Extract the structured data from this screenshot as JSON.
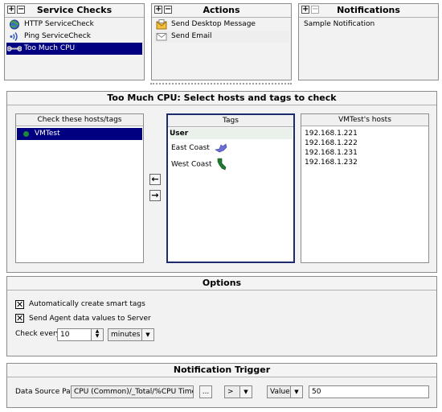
{
  "service_checks": {
    "title": "Service Checks",
    "items": [
      {
        "label": "HTTP ServiceCheck",
        "icon": "globe-icon"
      },
      {
        "label": "Ping ServiceCheck",
        "icon": "ping-waves-icon"
      },
      {
        "label": "Too Much CPU",
        "icon": "wrench-icon",
        "selected": true
      }
    ]
  },
  "actions": {
    "title": "Actions",
    "items": [
      {
        "label": "Send Desktop Message",
        "icon": "desktop-message-icon"
      },
      {
        "label": "Send Email",
        "icon": "email-icon"
      }
    ]
  },
  "notifications": {
    "title": "Notifications",
    "items": [
      {
        "label": "Sample Notification"
      }
    ]
  },
  "selection": {
    "title": "Too Much CPU: Select hosts and tags to check",
    "hosts_header": "Check these hosts/tags",
    "hosts": [
      {
        "label": "VMTest",
        "selected": true
      }
    ],
    "tags_header": "Tags",
    "tags": [
      {
        "label": "User",
        "bold": true
      },
      {
        "label": "East Coast",
        "icon": "map-state-icon"
      },
      {
        "label": "West Coast",
        "icon": "map-state-icon"
      }
    ],
    "vm_header": "VMTest's hosts",
    "vm_hosts": [
      "192.168.1.221",
      "192.168.1.222",
      "192.168.1.231",
      "192.168.1.232"
    ]
  },
  "options": {
    "title": "Options",
    "smart_tags_label": "Automatically create smart tags",
    "smart_tags_checked": true,
    "agent_label": "Send Agent data values to Server",
    "agent_checked": true,
    "check_every_label": "Check every",
    "check_every_value": "10",
    "unit_value": "minutes"
  },
  "trigger": {
    "title": "Notification Trigger",
    "source_label": "Data Source Path",
    "source_value": "CPU (Common)/_Total/%CPU Time",
    "browse_label": "...",
    "operator_value": ">",
    "mode_value": "Value",
    "threshold_value": "50"
  },
  "colors": {
    "selection": "#000080",
    "panel_bg": "#f2f2f2",
    "tag_box_border": "#1e2a6e",
    "host_dot": "#1a8a3a"
  }
}
